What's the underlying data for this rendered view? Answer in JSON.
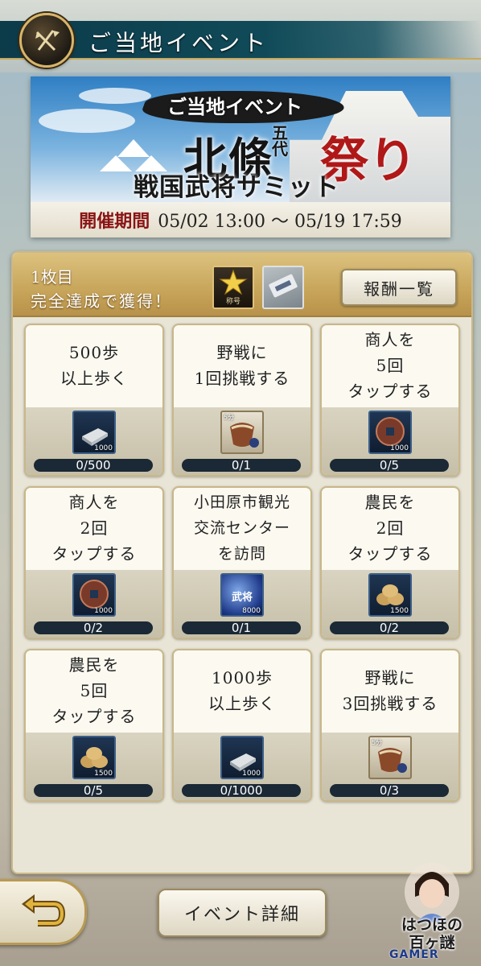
{
  "header": {
    "title": "ご当地イベント",
    "icon": "crossed-flags-icon"
  },
  "banner": {
    "subtitle": "ご当地イベント",
    "main_title": "北條",
    "small_text": "五代",
    "fest": "祭り",
    "summit": "戦国武将サミット",
    "period_label": "開催期間",
    "period_value": "05/02 13:00 ～ 05/19 17:59"
  },
  "panel": {
    "sheet_label": "1枚目",
    "complete_label": "完全達成で獲得！",
    "badge_label": "称号",
    "reward_list_button": "報酬一覧"
  },
  "missions": [
    {
      "task": "500歩\n以上歩く",
      "reward": "silver",
      "reward_qty": "1000",
      "time_tag": "",
      "progress": "0/500",
      "progress_value": 0
    },
    {
      "task": "野戦に\n1回挑戦する",
      "reward": "rice-sack",
      "reward_qty": "",
      "time_tag": "5分",
      "progress": "0/1",
      "progress_value": 0
    },
    {
      "task": "商人を\n5回\nタップする",
      "reward": "coin",
      "reward_qty": "1000",
      "time_tag": "",
      "progress": "0/5",
      "progress_value": 0
    },
    {
      "task": "商人を\n2回\nタップする",
      "reward": "coin",
      "reward_qty": "1000",
      "time_tag": "",
      "progress": "0/2",
      "progress_value": 0
    },
    {
      "task": "小田原市観光\n交流センター\nを訪問",
      "reward": "busho-orb",
      "reward_qty": "8000",
      "time_tag": "",
      "progress": "0/1",
      "progress_value": 0
    },
    {
      "task": "農民を\n2回\nタップする",
      "reward": "rice-bales",
      "reward_qty": "1500",
      "time_tag": "",
      "progress": "0/2",
      "progress_value": 0
    },
    {
      "task": "農民を\n5回\nタップする",
      "reward": "rice-bales",
      "reward_qty": "1500",
      "time_tag": "",
      "progress": "0/5",
      "progress_value": 0
    },
    {
      "task": "1000歩\n以上歩く",
      "reward": "silver",
      "reward_qty": "1000",
      "time_tag": "",
      "progress": "0/1000",
      "progress_value": 0
    },
    {
      "task": "野戦に\n3回挑戦する",
      "reward": "rice-sack",
      "reward_qty": "",
      "time_tag": "5分",
      "progress": "0/3",
      "progress_value": 0
    }
  ],
  "orb_text": "武将",
  "footer": {
    "back_icon": "return-arrow-icon",
    "detail_button": "イベント詳細",
    "character_caption_1": "はつほの",
    "character_caption_2": "百ヶ謎"
  },
  "watermark": "GAMER",
  "colors": {
    "header_bar": "#0c3b4a",
    "fest_red": "#b01818",
    "progress_bg": "#1b2835",
    "gold": "#c9a85a"
  }
}
